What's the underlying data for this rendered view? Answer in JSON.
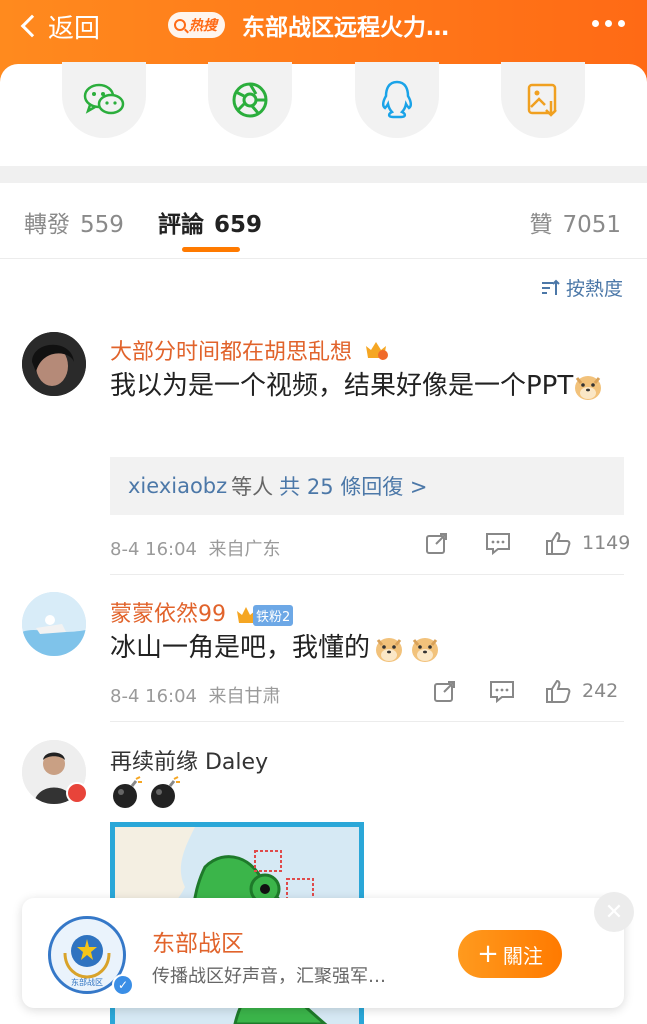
{
  "header": {
    "back_label": "返回",
    "hot_badge": "热搜",
    "title": "东部战区远程火力…",
    "accent": "#ff7a1a"
  },
  "share": {
    "items": [
      {
        "icon": "wechat-icon"
      },
      {
        "icon": "moments-icon"
      },
      {
        "icon": "qq-icon"
      },
      {
        "icon": "save-image-icon"
      }
    ]
  },
  "tabs": {
    "repost_label": "轉發",
    "repost_count": "559",
    "comment_label": "評論",
    "comment_count": "659",
    "like_label": "贊",
    "like_count": "7051"
  },
  "sort": {
    "label": "按熱度"
  },
  "comments": [
    {
      "username": "大部分时间都在胡思乱想",
      "text": "我以为是一个视频，结果好像是一个PPT",
      "reply_who": "xiexiaobz",
      "reply_etc": "等人",
      "reply_total": "共 25 條回復 >",
      "time": "8-4 16:04",
      "location": "来自广东",
      "likes": "1149"
    },
    {
      "username": "蒙蒙依然99",
      "fan_badge": "铁粉2",
      "text": "冰山一角是吧，我懂的",
      "time": "8-4 16:04",
      "location": "来自甘肃",
      "likes": "242"
    },
    {
      "username": "再续前缘 Daley"
    }
  ],
  "follow_card": {
    "name": "东部战区",
    "emblem_text": "东部战区",
    "desc": "传播战区好声音，汇聚强军…",
    "follow_label": "關注"
  }
}
